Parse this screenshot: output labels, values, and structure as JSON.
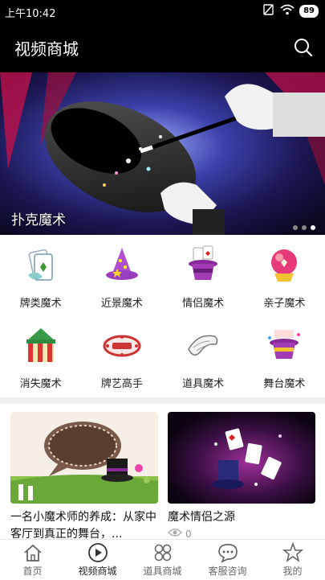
{
  "status_bar": {
    "time": "上午10:42",
    "battery": "89"
  },
  "header": {
    "title": "视频商城"
  },
  "banner": {
    "caption": "扑克魔术"
  },
  "categories": [
    {
      "label": "牌类魔术",
      "icon": "card-magic-icon"
    },
    {
      "label": "近景魔术",
      "icon": "wizard-hat-icon"
    },
    {
      "label": "情侣魔术",
      "icon": "top-hat-cards-icon"
    },
    {
      "label": "亲子魔术",
      "icon": "crystal-ball-icon"
    },
    {
      "label": "消失魔术",
      "icon": "circus-tent-icon"
    },
    {
      "label": "牌艺高手",
      "icon": "magic-sign-icon"
    },
    {
      "label": "道具魔术",
      "icon": "scroll-icon"
    },
    {
      "label": "舞台魔术",
      "icon": "stage-hat-icon"
    }
  ],
  "cards": [
    {
      "title": "一名小魔术师的养成：从家中客厅到真正的舞台，...",
      "views": ""
    },
    {
      "title": "魔术情侣之源",
      "views": "0"
    }
  ],
  "tabs": [
    {
      "label": "首页",
      "icon": "home-icon"
    },
    {
      "label": "视频商城",
      "icon": "play-icon"
    },
    {
      "label": "道具商城",
      "icon": "grid-icon"
    },
    {
      "label": "客服咨询",
      "icon": "chat-icon"
    },
    {
      "label": "我的",
      "icon": "star-icon"
    }
  ]
}
